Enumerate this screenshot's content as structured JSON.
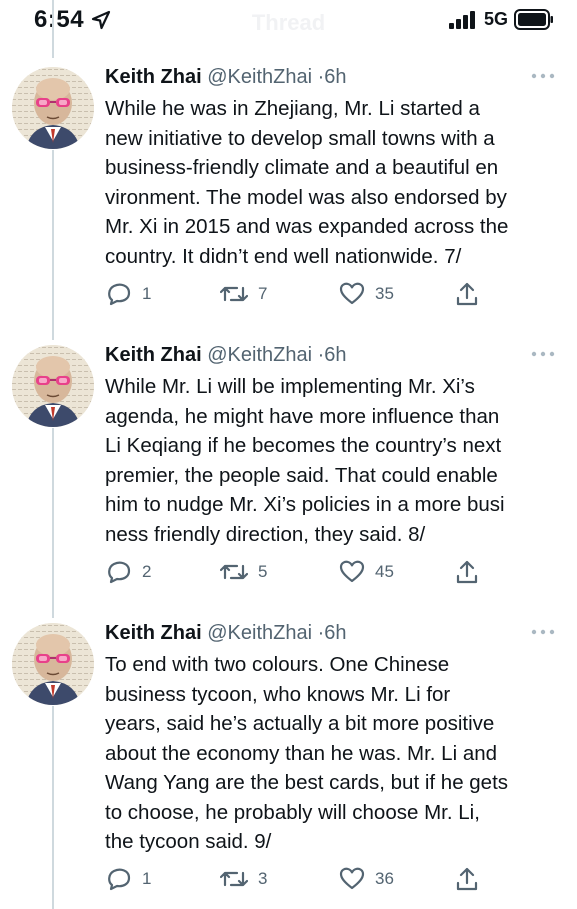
{
  "status_bar": {
    "time": "6:54",
    "header_title": "Thread",
    "network": "5G"
  },
  "icons": {
    "location": "location-arrow-icon",
    "signal": "cellular-signal-icon",
    "battery": "battery-icon",
    "more": "more-dots-icon",
    "reply": "reply-icon",
    "retweet": "retweet-icon",
    "like": "heart-icon",
    "share": "share-icon"
  },
  "colors": {
    "text": "#0f1419",
    "secondary": "#536471",
    "thread_line": "#cfd9de"
  },
  "tweets": [
    {
      "author": "Keith Zhai",
      "handle": "@KeithZhai",
      "separator": "·",
      "time": "6h",
      "text": "While he was in Zhejiang, Mr. Li started a\nnew initiative to develop small towns with a\nbusiness-friendly climate and a beautiful en\nvironment. The model was also endorsed by\nMr. Xi in 2015 and was expanded across the\ncountry. It didn’t end well nationwide. 7/",
      "replies": "1",
      "retweets": "7",
      "likes": "35"
    },
    {
      "author": "Keith Zhai",
      "handle": "@KeithZhai",
      "separator": "·",
      "time": "6h",
      "text": "While Mr. Li will be implementing Mr. Xi’s\nagenda, he might have more influence than\nLi Keqiang if he becomes the country’s next\npremier, the people said. That could enable\nhim to nudge Mr. Xi’s policies in a more busi\nness friendly direction, they said. 8/",
      "replies": "2",
      "retweets": "5",
      "likes": "45"
    },
    {
      "author": "Keith Zhai",
      "handle": "@KeithZhai",
      "separator": "·",
      "time": "6h",
      "text": "To end with two colours. One Chinese\nbusiness tycoon, who knows Mr. Li for\nyears, said he’s actually a bit more positive\nabout the economy than he was. Mr. Li and\nWang Yang are the best cards, but if he gets\nto choose, he probably will choose Mr. Li,\nthe tycoon said. 9/",
      "replies": "1",
      "retweets": "3",
      "likes": "36"
    }
  ]
}
